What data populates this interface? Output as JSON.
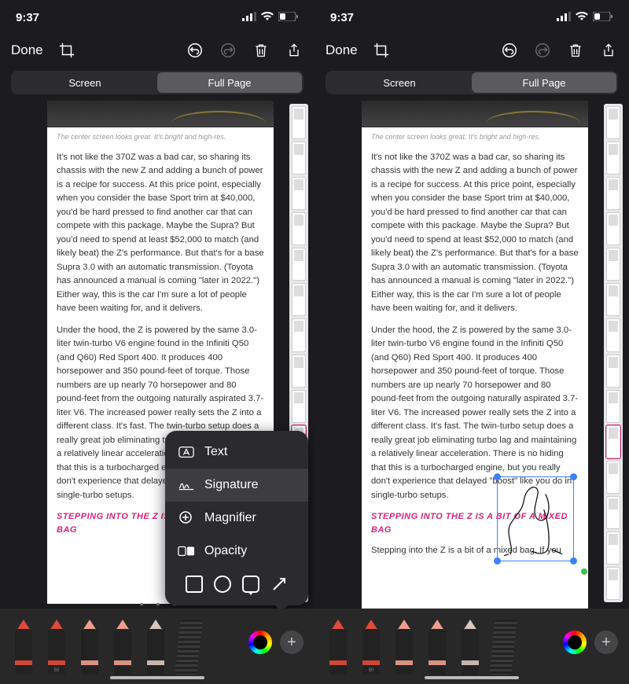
{
  "status": {
    "time": "9:37",
    "signal": "▮▮▮▯",
    "wifi": "wifi",
    "battery": "low"
  },
  "toolbar": {
    "done": "Done",
    "crop": "crop",
    "undo": "undo",
    "redo": "redo",
    "trash": "trash",
    "share": "share"
  },
  "segments": {
    "screen": "Screen",
    "fullpage": "Full Page",
    "active": "fullpage"
  },
  "article": {
    "caption": "The center screen looks great. It's bright and high-res.",
    "p1": "It's not like the 370Z was a bad car, so sharing its chassis with the new Z and adding a bunch of power is a recipe for success. At this price point, especially when you consider the base Sport trim at $40,000, you'd be hard pressed to find another car that can compete with this package. Maybe the Supra? But you'd need to spend at least $52,000 to match (and likely beat) the Z's performance. But that's for a base Supra 3.0 with an automatic transmission. (Toyota has announced a manual is coming \"later in 2022.\") Either way, this is the car I'm sure a lot of people have been waiting for, and it delivers.",
    "p2": "Under the hood, the Z is powered by the same 3.0-liter twin-turbo V6 engine found in the Infiniti Q50 (and Q60) Red Sport 400. It produces 400 horsepower and 350 pound-feet of torque. Those numbers are up nearly 70 horsepower and 80 pound-feet from the outgoing naturally aspirated 3.7-liter V6. The increased power really sets the Z into a different class. It's fast. The twin-turbo setup does a really great job eliminating turbo lag and maintaining a relatively linear acceleration. There is no hiding that this is a turbocharged engine, but you really don't experience that delayed \"boost\" like you do in single-turbo setups.",
    "subhead": "STEPPING INTO THE Z IS A BIT OF A MIXED BAG",
    "p3": "Stepping into the Z is a bit of a mixed bag. If you"
  },
  "popup": {
    "items": [
      {
        "icon": "text",
        "label": "Text"
      },
      {
        "icon": "signature",
        "label": "Signature"
      },
      {
        "icon": "magnifier",
        "label": "Magnifier"
      },
      {
        "icon": "opacity",
        "label": "Opacity"
      }
    ],
    "selected": 1,
    "shapes": [
      "square",
      "circle",
      "bubble",
      "arrow"
    ]
  },
  "tools": {
    "pens": [
      {
        "color": "#e04a3a",
        "label": ""
      },
      {
        "color": "#e04a3a",
        "label": "50"
      },
      {
        "color": "#ed9e8c",
        "label": ""
      },
      {
        "color": "#ed9e8c",
        "label": ""
      },
      {
        "color": "#d9c7bc",
        "label": ""
      }
    ]
  },
  "thumb_strip": {
    "count": 14,
    "selected": 9
  },
  "page_dots": "• • •"
}
